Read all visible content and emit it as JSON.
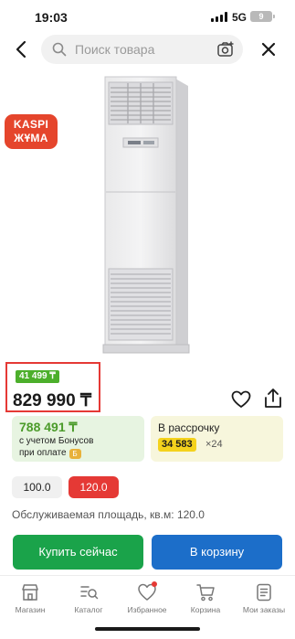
{
  "status_bar": {
    "time": "19:03",
    "network": "5G",
    "battery": "9"
  },
  "header": {
    "search_placeholder": "Поиск товара"
  },
  "badge": {
    "line1": "KASPI",
    "line2": "ЖҰМА"
  },
  "price": {
    "monthly": "41 499 ₸",
    "total": "829 990 ₸"
  },
  "bonus_card": {
    "amount": "788 491 ₸",
    "text_line1": "с учетом Бонусов",
    "text_line2": "при оплате",
    "coin_label": "Б"
  },
  "installment_card": {
    "title": "В рассрочку",
    "amount": "34 583",
    "months": "×24"
  },
  "area_options": [
    {
      "label": "100.0",
      "selected": false
    },
    {
      "label": "120.0",
      "selected": true
    }
  ],
  "spec": {
    "label": "Обслуживаемая площадь, кв.м: 120.0"
  },
  "actions": {
    "buy_now": "Купить сейчас",
    "add_to_cart": "В корзину"
  },
  "bottom_nav": [
    {
      "label": "Магазин",
      "icon": "store-icon"
    },
    {
      "label": "Каталог",
      "icon": "catalog-icon"
    },
    {
      "label": "Избранное",
      "icon": "heart-icon"
    },
    {
      "label": "Корзина",
      "icon": "cart-icon"
    },
    {
      "label": "Мои заказы",
      "icon": "orders-icon"
    }
  ],
  "colors": {
    "accent_red": "#e53935",
    "buy_green": "#1aa34a",
    "cart_blue": "#1c6ec9",
    "bonus_green": "#4b9b2a",
    "installment_yellow": "#f4d21d"
  }
}
